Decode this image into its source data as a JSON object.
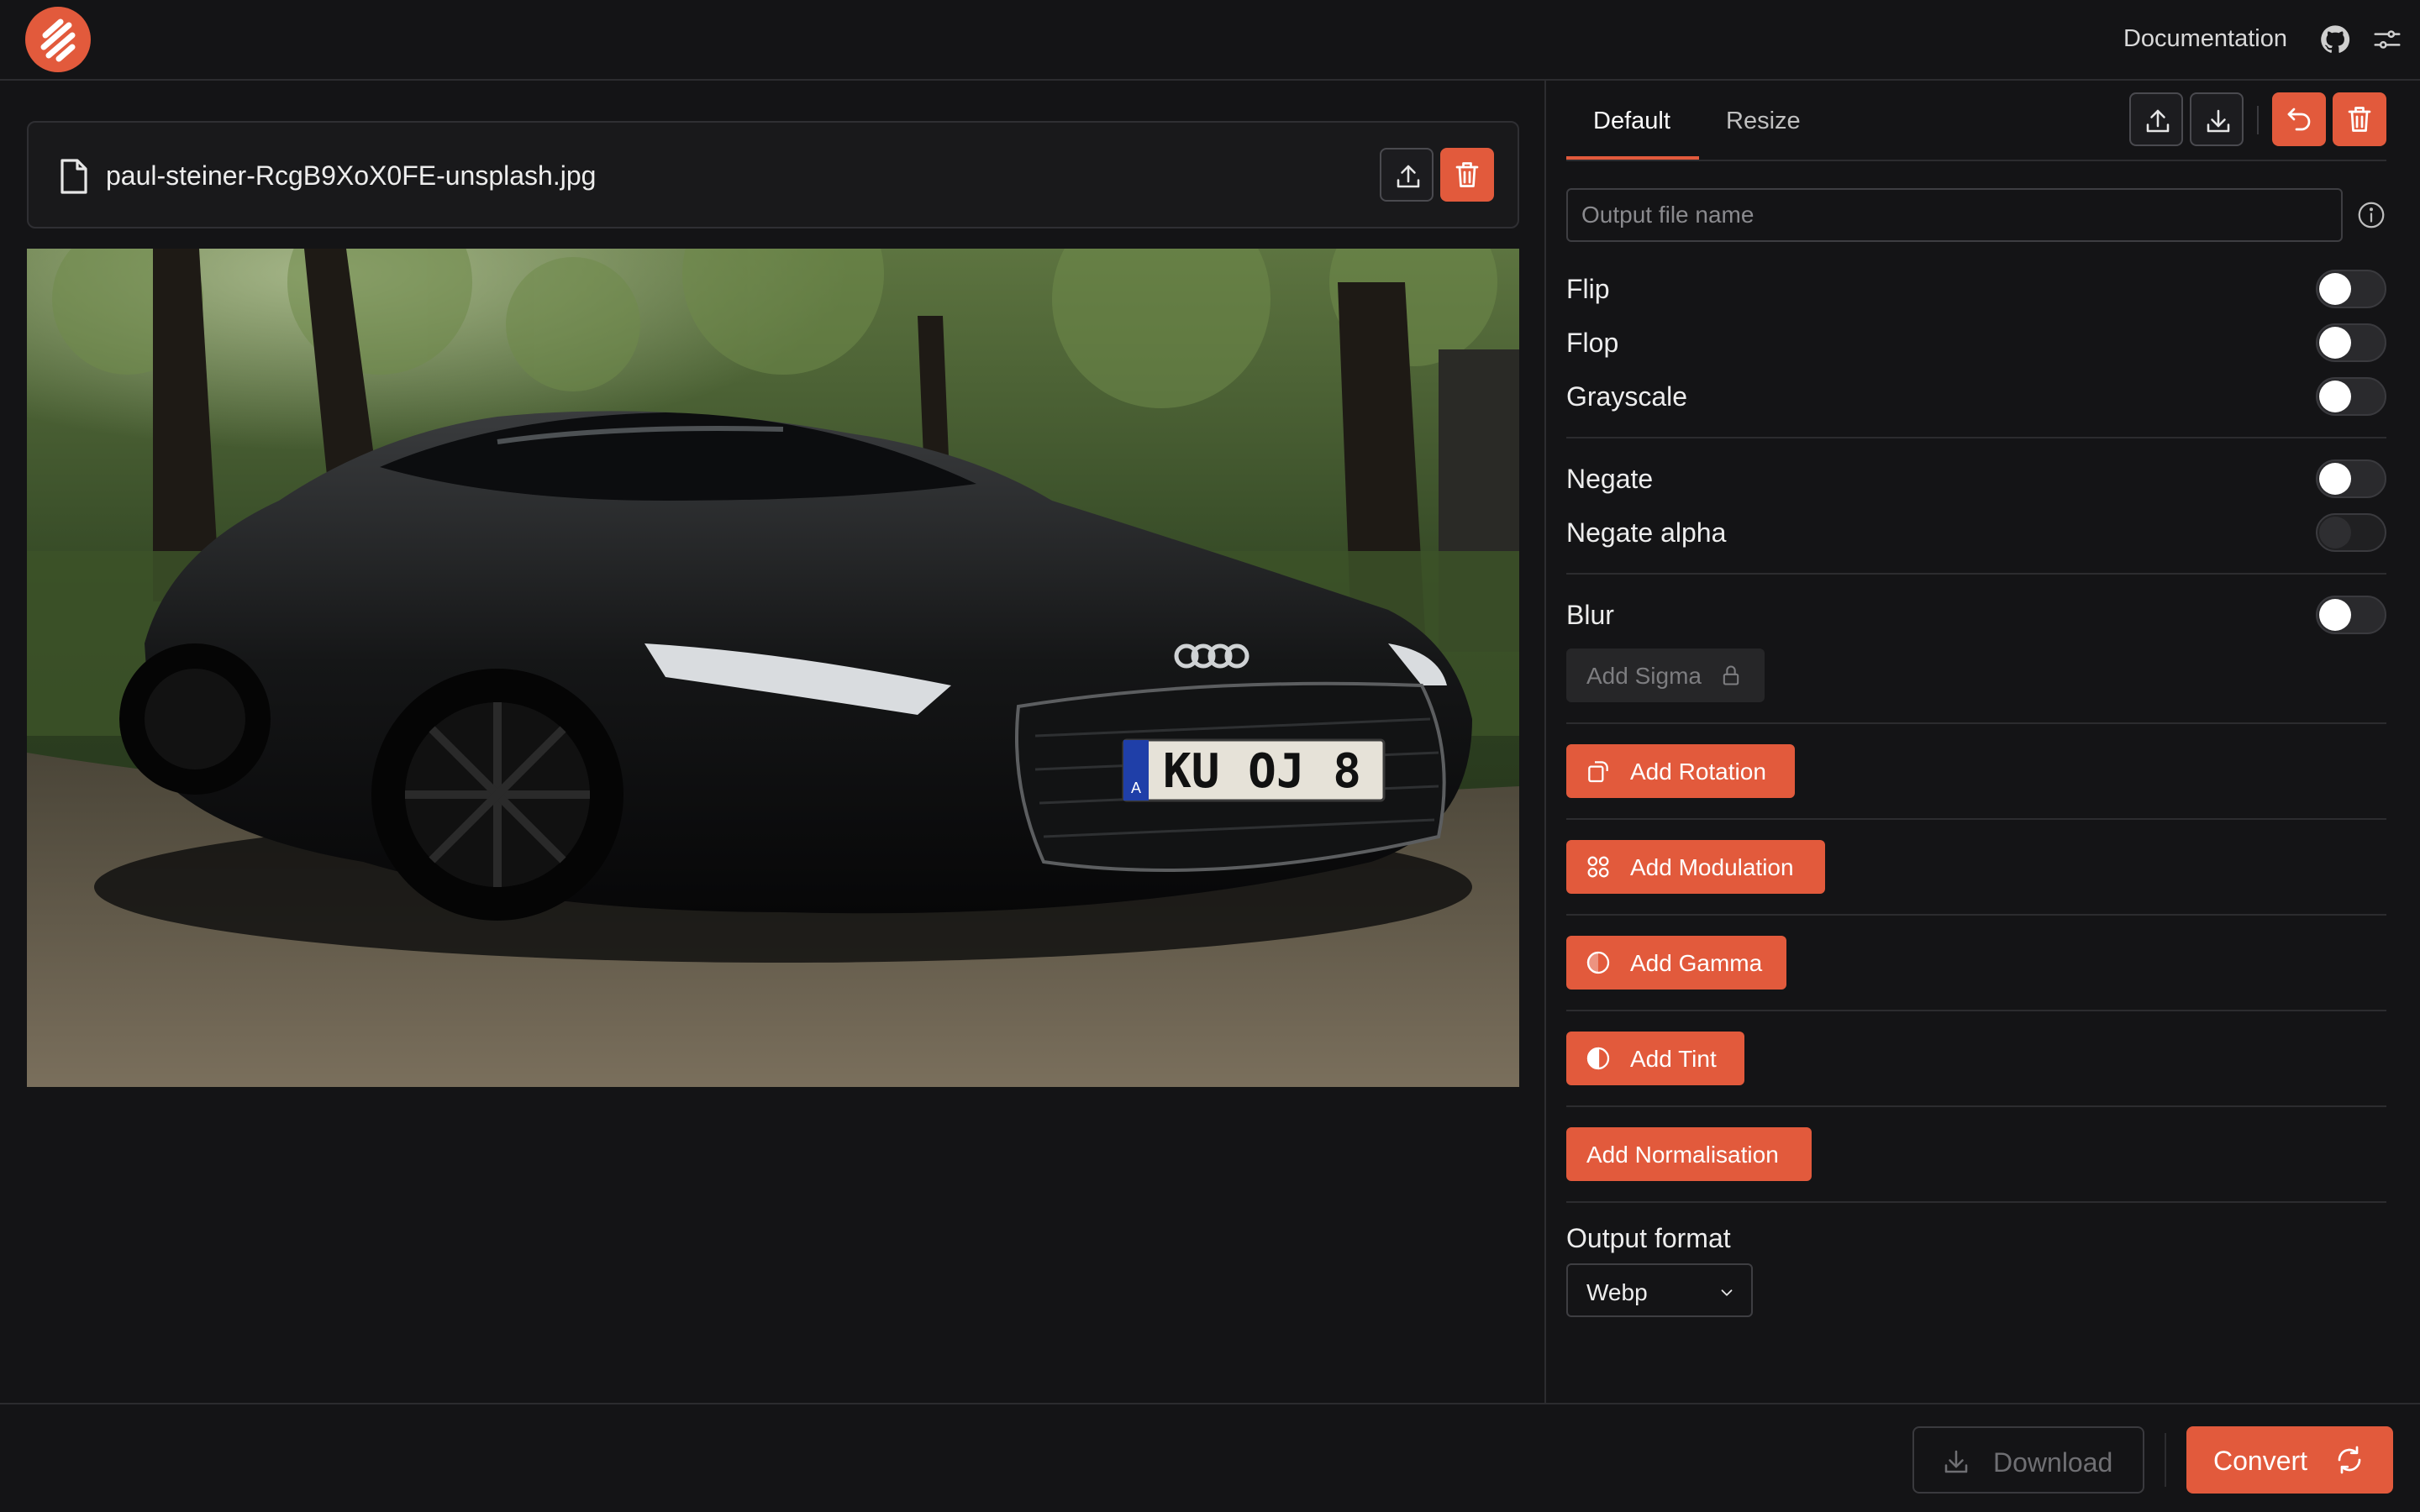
{
  "header": {
    "documentation_label": "Documentation",
    "icons": [
      "logo-icon",
      "github-icon",
      "settings-sliders-icon"
    ]
  },
  "file": {
    "name": "paul-steiner-RcgB9XoX0FE-unsplash.jpg"
  },
  "preview": {
    "license_plate": "KU OJ 8",
    "plate_country": "A"
  },
  "panel": {
    "tabs": [
      {
        "label": "Default",
        "active": true
      },
      {
        "label": "Resize",
        "active": false
      }
    ],
    "output_file_name_placeholder": "Output file name",
    "toggles": [
      {
        "label": "Flip",
        "on": false,
        "disabled": false
      },
      {
        "label": "Flop",
        "on": false,
        "disabled": false
      },
      {
        "label": "Grayscale",
        "on": false,
        "disabled": false
      },
      {
        "label": "Negate",
        "on": false,
        "disabled": false
      },
      {
        "label": "Negate alpha",
        "on": false,
        "disabled": true
      },
      {
        "label": "Blur",
        "on": false,
        "disabled": false
      }
    ],
    "add_sigma_label": "Add Sigma",
    "buttons": {
      "rotation": "Add Rotation",
      "modulation": "Add Modulation",
      "gamma": "Add Gamma",
      "tint": "Add Tint",
      "normalisation": "Add Normalisation"
    },
    "output_format_label": "Output format",
    "output_format_value": "Webp"
  },
  "footer": {
    "download_label": "Download",
    "convert_label": "Convert"
  },
  "colors": {
    "accent": "#e25a3c",
    "background": "#141416",
    "border": "#2c2c2f"
  }
}
